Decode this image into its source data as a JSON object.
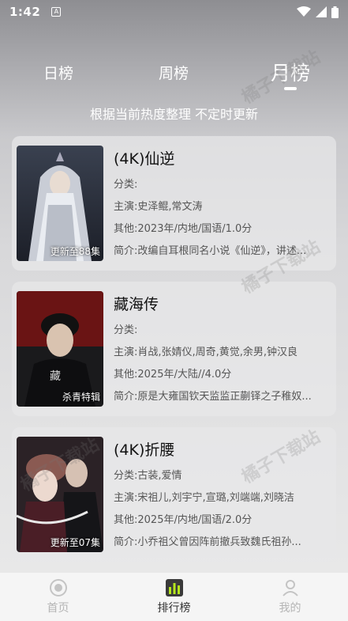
{
  "status": {
    "time": "1:42",
    "notification_glyph": "A"
  },
  "tabs": [
    {
      "label": "日榜",
      "active": false
    },
    {
      "label": "周榜",
      "active": false
    },
    {
      "label": "月榜",
      "active": true
    }
  ],
  "subtitle": "根据当前热度整理 不定时更新",
  "watermark_text": "橘子下载站",
  "labels": {
    "category": "分类:",
    "cast": "主演:",
    "other": "其他:",
    "intro": "简介:"
  },
  "items": [
    {
      "title": "(4K)仙逆",
      "badge": "更新至88集",
      "category": "",
      "cast": "史泽鲲,常文涛",
      "other": "2023年/内地/国语/1.0分",
      "intro": "改编自耳根同名小说《仙逆》，讲述..."
    },
    {
      "title": "藏海传",
      "badge": "杀青特辑",
      "category": "",
      "cast": "肖战,张婧仪,周奇,黄觉,余男,钟汉良",
      "other": "2025年/大陆//4.0分",
      "intro": "原是大雍国钦天监监正蒯铎之子稚奴..."
    },
    {
      "title": "(4K)折腰",
      "badge": "更新至07集",
      "category": "古装,爱情",
      "cast": "宋祖儿,刘宇宁,宣璐,刘端端,刘晓洁",
      "other": "2025年/内地/国语/2.0分",
      "intro": "小乔祖父曾因阵前撤兵致魏氏祖孙..."
    }
  ],
  "nav": [
    {
      "label": "首页",
      "icon": "home-icon",
      "active": false
    },
    {
      "label": "排行榜",
      "icon": "ranking-icon",
      "active": true
    },
    {
      "label": "我的",
      "icon": "profile-icon",
      "active": false
    }
  ]
}
